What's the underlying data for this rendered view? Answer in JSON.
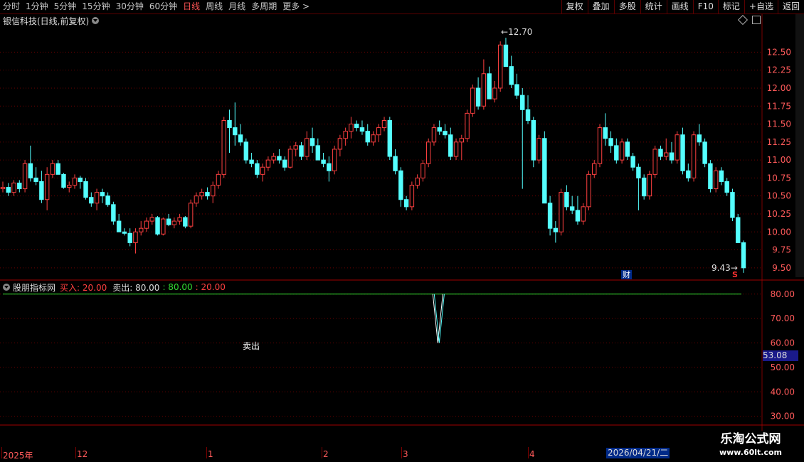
{
  "toolbar": {
    "periods": [
      "分时",
      "1分钟",
      "5分钟",
      "15分钟",
      "30分钟",
      "60分钟",
      "日线",
      "周线",
      "月线",
      "多周期",
      "更多 >"
    ],
    "active_period": "日线",
    "right_buttons": [
      "复权",
      "叠加",
      "多股",
      "统计",
      "画线",
      "F10",
      "标记",
      "+自选",
      "返回"
    ]
  },
  "stock": {
    "title": "银信科技(日线,前复权)"
  },
  "main_axis": {
    "ticks": [
      "12.50",
      "12.25",
      "12.00",
      "11.75",
      "11.50",
      "11.25",
      "11.00",
      "10.75",
      "10.50",
      "10.25",
      "10.00",
      "9.75",
      "9.50"
    ]
  },
  "annotations": {
    "high": "12.70",
    "low": "9.43",
    "cai": "财",
    "s_mark": "S"
  },
  "indicator": {
    "name": "股朋指标网",
    "buy_label": "买入: 20.00",
    "sell_label": "卖出: 80.00",
    "v3": ": 80.00",
    "v4": ": 20.00",
    "axis_ticks": [
      "80.00",
      "70.00",
      "60.00",
      "50.00",
      "40.00",
      "30.00"
    ],
    "current_value": "53.08",
    "sell_signal_text": "卖出"
  },
  "date_axis": {
    "labels": [
      "2025年",
      "12",
      "1",
      "2",
      "3",
      "4"
    ],
    "selected": "2026/04/21/二"
  },
  "watermark": {
    "line1": "乐淘公式网",
    "line2": "www.60lt.com"
  },
  "colors": {
    "up": "#ff4040",
    "down": "#54ffff",
    "grid": "#6a0000",
    "line_green": "#33dd33"
  },
  "chart_data": {
    "type": "candlestick",
    "ylim": [
      9.35,
      12.85
    ],
    "candles": [
      [
        10.6,
        10.7,
        10.55,
        10.62
      ],
      [
        10.62,
        10.68,
        10.5,
        10.55
      ],
      [
        10.55,
        10.72,
        10.5,
        10.68
      ],
      [
        10.68,
        10.72,
        10.55,
        10.6
      ],
      [
        10.6,
        11.0,
        10.55,
        10.95
      ],
      [
        10.95,
        11.2,
        10.7,
        10.75
      ],
      [
        10.75,
        10.9,
        10.65,
        10.7
      ],
      [
        10.7,
        10.85,
        10.4,
        10.45
      ],
      [
        10.45,
        10.9,
        10.3,
        10.8
      ],
      [
        10.8,
        11.0,
        10.75,
        10.95
      ],
      [
        10.95,
        11.0,
        10.8,
        10.8
      ],
      [
        10.8,
        10.82,
        10.6,
        10.62
      ],
      [
        10.62,
        10.7,
        10.55,
        10.65
      ],
      [
        10.65,
        10.8,
        10.6,
        10.75
      ],
      [
        10.75,
        10.78,
        10.6,
        10.7
      ],
      [
        10.7,
        10.75,
        10.45,
        10.48
      ],
      [
        10.48,
        10.55,
        10.35,
        10.4
      ],
      [
        10.4,
        10.6,
        10.3,
        10.55
      ],
      [
        10.55,
        10.6,
        10.4,
        10.5
      ],
      [
        10.5,
        10.55,
        10.35,
        10.38
      ],
      [
        10.38,
        10.42,
        10.1,
        10.15
      ],
      [
        10.15,
        10.25,
        10.0,
        10.0
      ],
      [
        10.0,
        10.05,
        9.95,
        9.98
      ],
      [
        9.98,
        10.05,
        9.8,
        9.85
      ],
      [
        9.85,
        10.05,
        9.7,
        10.0
      ],
      [
        10.0,
        10.15,
        9.95,
        10.05
      ],
      [
        10.05,
        10.2,
        10.0,
        10.15
      ],
      [
        10.15,
        10.25,
        10.1,
        10.2
      ],
      [
        10.2,
        10.22,
        9.95,
        9.97
      ],
      [
        9.97,
        10.2,
        9.95,
        10.18
      ],
      [
        10.18,
        10.25,
        10.08,
        10.1
      ],
      [
        10.1,
        10.2,
        10.05,
        10.15
      ],
      [
        10.15,
        10.25,
        10.1,
        10.2
      ],
      [
        10.2,
        10.22,
        10.05,
        10.08
      ],
      [
        10.08,
        10.45,
        10.05,
        10.4
      ],
      [
        10.4,
        10.55,
        10.35,
        10.5
      ],
      [
        10.5,
        10.6,
        10.45,
        10.55
      ],
      [
        10.55,
        10.62,
        10.45,
        10.5
      ],
      [
        10.5,
        10.7,
        10.4,
        10.65
      ],
      [
        10.65,
        10.85,
        10.6,
        10.8
      ],
      [
        10.8,
        11.6,
        10.75,
        11.55
      ],
      [
        11.55,
        11.7,
        11.1,
        11.45
      ],
      [
        11.45,
        11.8,
        11.2,
        11.35
      ],
      [
        11.35,
        11.5,
        11.2,
        11.25
      ],
      [
        11.25,
        11.3,
        10.95,
        11.0
      ],
      [
        11.0,
        11.1,
        10.9,
        10.95
      ],
      [
        10.95,
        11.0,
        10.75,
        10.8
      ],
      [
        10.8,
        10.95,
        10.7,
        10.9
      ],
      [
        10.9,
        11.05,
        10.85,
        11.0
      ],
      [
        11.0,
        11.1,
        10.95,
        11.05
      ],
      [
        11.05,
        11.15,
        10.95,
        11.0
      ],
      [
        11.0,
        11.05,
        10.85,
        10.9
      ],
      [
        10.9,
        11.2,
        10.88,
        11.15
      ],
      [
        11.15,
        11.25,
        11.05,
        11.2
      ],
      [
        11.2,
        11.25,
        11.0,
        11.05
      ],
      [
        11.05,
        11.4,
        11.0,
        11.3
      ],
      [
        11.3,
        11.45,
        11.1,
        11.2
      ],
      [
        11.2,
        11.3,
        11.0,
        11.0
      ],
      [
        11.0,
        11.1,
        10.9,
        10.95
      ],
      [
        10.95,
        11.05,
        10.7,
        10.85
      ],
      [
        10.85,
        11.2,
        10.8,
        11.15
      ],
      [
        11.15,
        11.35,
        11.05,
        11.3
      ],
      [
        11.3,
        11.45,
        11.2,
        11.4
      ],
      [
        11.4,
        11.6,
        11.3,
        11.5
      ],
      [
        11.5,
        11.55,
        11.4,
        11.45
      ],
      [
        11.45,
        11.55,
        11.35,
        11.4
      ],
      [
        11.4,
        11.5,
        11.2,
        11.25
      ],
      [
        11.25,
        11.4,
        11.2,
        11.35
      ],
      [
        11.35,
        11.5,
        11.25,
        11.45
      ],
      [
        11.45,
        11.6,
        11.4,
        11.55
      ],
      [
        11.55,
        11.6,
        11.0,
        11.05
      ],
      [
        11.05,
        11.15,
        10.8,
        10.85
      ],
      [
        10.85,
        10.9,
        10.35,
        10.45
      ],
      [
        10.45,
        10.5,
        10.3,
        10.35
      ],
      [
        10.35,
        10.7,
        10.3,
        10.65
      ],
      [
        10.65,
        10.8,
        10.6,
        10.75
      ],
      [
        10.75,
        11.0,
        10.7,
        10.95
      ],
      [
        10.95,
        11.3,
        10.9,
        11.25
      ],
      [
        11.25,
        11.5,
        11.2,
        11.45
      ],
      [
        11.45,
        11.55,
        11.35,
        11.4
      ],
      [
        11.4,
        11.5,
        11.3,
        11.35
      ],
      [
        11.35,
        11.45,
        11.0,
        11.05
      ],
      [
        11.05,
        11.3,
        11.0,
        11.25
      ],
      [
        11.25,
        11.35,
        11.0,
        11.3
      ],
      [
        11.3,
        11.7,
        11.25,
        11.65
      ],
      [
        11.65,
        12.05,
        11.6,
        12.0
      ],
      [
        12.0,
        12.15,
        11.7,
        11.75
      ],
      [
        11.75,
        12.4,
        11.7,
        12.2
      ],
      [
        12.2,
        12.3,
        11.85,
        11.85
      ],
      [
        11.85,
        12.1,
        11.8,
        12.0
      ],
      [
        12.0,
        12.65,
        11.95,
        12.6
      ],
      [
        12.6,
        12.7,
        12.3,
        12.3
      ],
      [
        12.3,
        12.45,
        12.0,
        12.05
      ],
      [
        12.05,
        12.2,
        11.85,
        11.9
      ],
      [
        11.9,
        12.0,
        10.6,
        11.7
      ],
      [
        11.7,
        11.9,
        11.5,
        11.55
      ],
      [
        11.55,
        11.6,
        10.9,
        11.0
      ],
      [
        11.0,
        11.35,
        10.95,
        11.3
      ],
      [
        11.3,
        11.4,
        10.4,
        10.4
      ],
      [
        10.4,
        10.5,
        9.95,
        10.05
      ],
      [
        10.05,
        10.15,
        9.85,
        10.0
      ],
      [
        10.0,
        10.6,
        9.95,
        10.55
      ],
      [
        10.55,
        10.65,
        10.3,
        10.35
      ],
      [
        10.35,
        10.5,
        10.25,
        10.3
      ],
      [
        10.3,
        10.5,
        10.1,
        10.15
      ],
      [
        10.15,
        10.4,
        10.1,
        10.35
      ],
      [
        10.35,
        10.85,
        10.3,
        10.8
      ],
      [
        10.8,
        11.0,
        10.75,
        10.95
      ],
      [
        10.95,
        11.5,
        10.9,
        11.45
      ],
      [
        11.45,
        11.65,
        11.2,
        11.3
      ],
      [
        11.3,
        11.4,
        11.1,
        11.2
      ],
      [
        11.2,
        11.3,
        10.95,
        11.0
      ],
      [
        11.0,
        11.3,
        10.95,
        11.25
      ],
      [
        11.25,
        11.3,
        11.0,
        11.05
      ],
      [
        11.05,
        11.1,
        10.85,
        10.9
      ],
      [
        10.9,
        10.95,
        10.3,
        10.75
      ],
      [
        10.75,
        10.8,
        10.45,
        10.5
      ],
      [
        10.5,
        10.85,
        10.45,
        10.8
      ],
      [
        10.8,
        11.2,
        10.75,
        11.15
      ],
      [
        11.15,
        11.2,
        11.0,
        11.05
      ],
      [
        11.05,
        11.3,
        11.0,
        11.1
      ],
      [
        11.1,
        11.25,
        10.95,
        11.0
      ],
      [
        11.0,
        11.4,
        10.95,
        11.35
      ],
      [
        11.35,
        11.45,
        10.8,
        10.85
      ],
      [
        10.85,
        10.95,
        10.7,
        10.75
      ],
      [
        10.75,
        11.4,
        10.7,
        11.35
      ],
      [
        11.35,
        11.5,
        11.2,
        11.25
      ],
      [
        11.25,
        11.3,
        10.9,
        10.95
      ],
      [
        10.95,
        11.0,
        10.55,
        10.6
      ],
      [
        10.6,
        10.9,
        10.55,
        10.85
      ],
      [
        10.85,
        10.9,
        10.65,
        10.7
      ],
      [
        10.7,
        10.75,
        10.5,
        10.55
      ],
      [
        10.55,
        10.6,
        10.15,
        10.2
      ],
      [
        10.2,
        10.25,
        9.85,
        9.85
      ],
      [
        9.85,
        9.88,
        9.43,
        9.5
      ]
    ],
    "indicator_series": {
      "line_level": 80,
      "dip": [
        {
          "index": 46,
          "value": 80
        },
        {
          "index": 47,
          "value": 60
        },
        {
          "index": 48,
          "value": 80
        }
      ],
      "ylim": [
        27,
        84
      ]
    }
  }
}
